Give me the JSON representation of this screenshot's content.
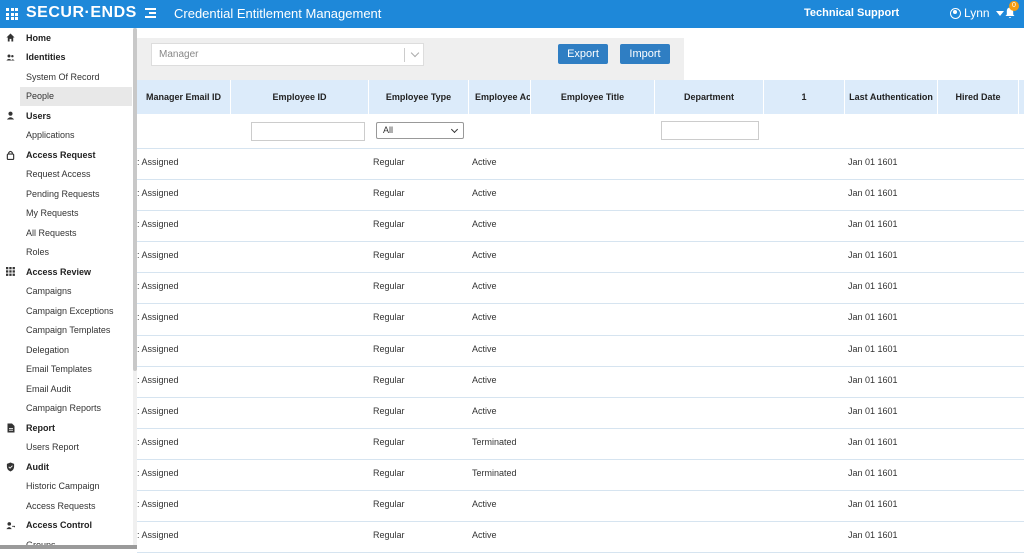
{
  "header": {
    "logo": "SECUR·ENDS",
    "title": "Credential Entitlement Management",
    "tech_support": "Technical Support",
    "user_name": "Lynn",
    "notification_count": "0"
  },
  "sidebar": {
    "sections": [
      {
        "label": "Home",
        "icon": "home-icon",
        "items": []
      },
      {
        "label": "Identities",
        "icon": "people-icon",
        "items": [
          "System Of Record",
          "People"
        ]
      },
      {
        "label": "Users",
        "icon": "user-icon",
        "items": [
          "Applications"
        ]
      },
      {
        "label": "Access Request",
        "icon": "lock-icon",
        "items": [
          "Request Access",
          "Pending Requests",
          "My Requests",
          "All Requests",
          "Roles"
        ]
      },
      {
        "label": "Access Review",
        "icon": "grid-icon",
        "items": [
          "Campaigns",
          "Campaign Exceptions",
          "Campaign Templates",
          "Delegation",
          "Email Templates",
          "Email Audit",
          "Campaign Reports"
        ]
      },
      {
        "label": "Report",
        "icon": "report-icon",
        "items": [
          "Users Report"
        ]
      },
      {
        "label": "Audit",
        "icon": "shield-icon",
        "items": [
          "Historic Campaign",
          "Access Requests"
        ]
      },
      {
        "label": "Access Control",
        "icon": "user-key-icon",
        "items": [
          "Groups"
        ]
      }
    ],
    "active_item": "People"
  },
  "toolbar": {
    "manager_placeholder": "Manager",
    "export_label": "Export",
    "import_label": "Import"
  },
  "table": {
    "columns": [
      "Manager Email ID",
      "Employee ID",
      "Employee Type",
      "Employee Ac",
      "Employee Title",
      "Department",
      "1",
      "Last Authentication",
      "Hired Date"
    ],
    "filter_type_value": "All",
    "rows": [
      {
        "manager": ": Assigned",
        "type": "Regular",
        "status": "Active",
        "last_auth": "Jan 01 1601"
      },
      {
        "manager": ": Assigned",
        "type": "Regular",
        "status": "Active",
        "last_auth": "Jan 01 1601"
      },
      {
        "manager": ": Assigned",
        "type": "Regular",
        "status": "Active",
        "last_auth": "Jan 01 1601"
      },
      {
        "manager": ": Assigned",
        "type": "Regular",
        "status": "Active",
        "last_auth": "Jan 01 1601"
      },
      {
        "manager": ": Assigned",
        "type": "Regular",
        "status": "Active",
        "last_auth": "Jan 01 1601"
      },
      {
        "manager": ": Assigned",
        "type": "Regular",
        "status": "Active",
        "last_auth": "Jan 01 1601"
      },
      {
        "manager": ": Assigned",
        "type": "Regular",
        "status": "Active",
        "last_auth": "Jan 01 1601"
      },
      {
        "manager": ": Assigned",
        "type": "Regular",
        "status": "Active",
        "last_auth": "Jan 01 1601"
      },
      {
        "manager": ": Assigned",
        "type": "Regular",
        "status": "Active",
        "last_auth": "Jan 01 1601"
      },
      {
        "manager": ": Assigned",
        "type": "Regular",
        "status": "Terminated",
        "last_auth": "Jan 01 1601"
      },
      {
        "manager": ": Assigned",
        "type": "Regular",
        "status": "Terminated",
        "last_auth": "Jan 01 1601"
      },
      {
        "manager": ": Assigned",
        "type": "Regular",
        "status": "Active",
        "last_auth": "Jan 01 1601"
      },
      {
        "manager": ": Assigned",
        "type": "Regular",
        "status": "Active",
        "last_auth": "Jan 01 1601"
      }
    ]
  },
  "colors": {
    "topbar": "#1e88d9",
    "button": "#2f7ec3",
    "table_header": "#dcebfa",
    "badge": "#f39c12"
  }
}
